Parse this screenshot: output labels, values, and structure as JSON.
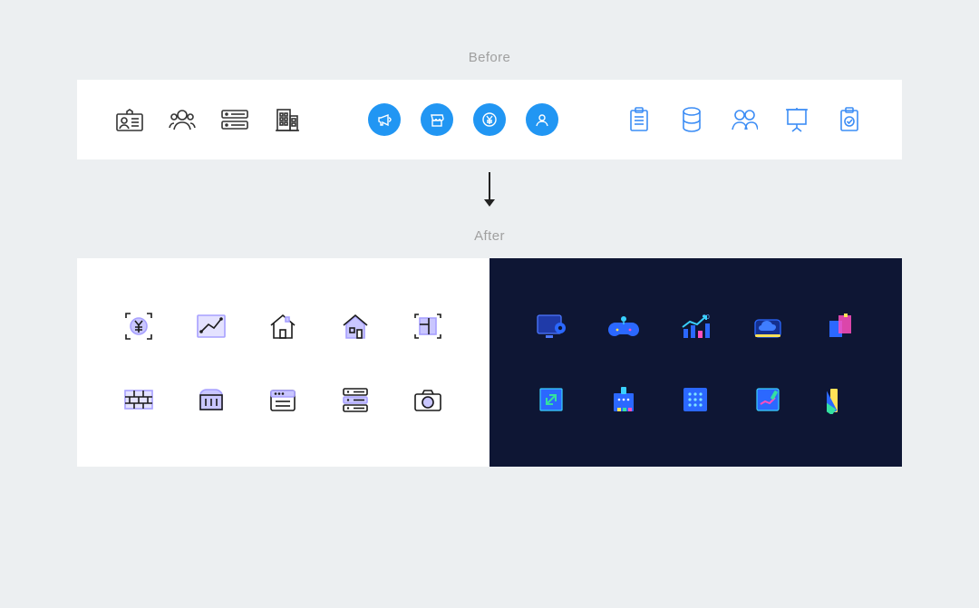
{
  "labels": {
    "before": "Before",
    "after": "After"
  },
  "colors": {
    "panel": "#ffffff",
    "dark_panel": "#0e1634",
    "blue_circle": "#2196f3",
    "blue_outline": "#3c8df5",
    "black_outline": "#333333",
    "accent_lilac": "#c9c6ff"
  },
  "before_groups": {
    "dark_outline": [
      {
        "name": "id-card-icon"
      },
      {
        "name": "people-group-icon"
      },
      {
        "name": "credit-card-stack-icon"
      },
      {
        "name": "building-icon"
      }
    ],
    "filled_circles": [
      {
        "name": "megaphone-circle-icon"
      },
      {
        "name": "store-circle-icon"
      },
      {
        "name": "yen-circle-icon"
      },
      {
        "name": "user-circle-icon"
      }
    ],
    "blue_outline": [
      {
        "name": "clipboard-list-icon"
      },
      {
        "name": "database-icon"
      },
      {
        "name": "users-outline-icon"
      },
      {
        "name": "presentation-icon"
      },
      {
        "name": "shield-check-icon"
      }
    ]
  },
  "after_light_icons": [
    {
      "name": "yen-frame-icon"
    },
    {
      "name": "line-chart-icon"
    },
    {
      "name": "house-outline-icon"
    },
    {
      "name": "house-duotone-icon"
    },
    {
      "name": "blueprint-icon"
    },
    {
      "name": "firewall-icon"
    },
    {
      "name": "container-icon"
    },
    {
      "name": "calendar-app-icon"
    },
    {
      "name": "server-rack-icon"
    },
    {
      "name": "camera-icon"
    }
  ],
  "after_dark_icons": [
    {
      "name": "monitor-gear-icon"
    },
    {
      "name": "gamepad-neon-icon"
    },
    {
      "name": "trend-chart-neon-icon",
      "annotation": "30"
    },
    {
      "name": "cloud-badge-icon"
    },
    {
      "name": "stacked-blocks-icon"
    },
    {
      "name": "scale-window-icon"
    },
    {
      "name": "marker-board-icon"
    },
    {
      "name": "app-grid-neon-icon"
    },
    {
      "name": "edit-note-neon-icon"
    },
    {
      "name": "palette-swatch-icon"
    }
  ]
}
